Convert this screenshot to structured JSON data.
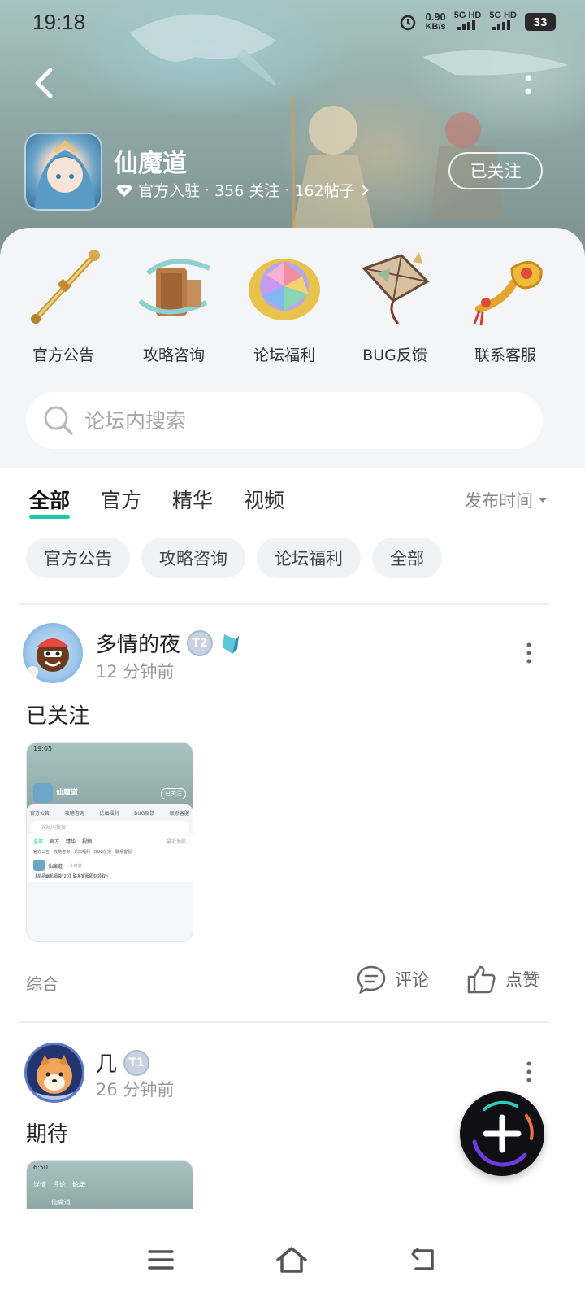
{
  "status_bar": {
    "time": "19:18",
    "net_speed_value": "0.90",
    "net_speed_unit": "KB/s",
    "sim1": "5G HD",
    "sim2": "5G HD",
    "battery": "33"
  },
  "header": {
    "game_title": "仙魔道",
    "meta_official": "官方入驻",
    "meta_follows": "356 关注",
    "meta_posts": "162帖子",
    "separator": "·",
    "follow_label": "已关注"
  },
  "categories": [
    {
      "label": "官方公告",
      "icon": "golden-staff-icon"
    },
    {
      "label": "攻略咨询",
      "icon": "scroll-tome-icon"
    },
    {
      "label": "论坛福利",
      "icon": "rainbow-gem-icon"
    },
    {
      "label": "BUG反馈",
      "icon": "kite-icon"
    },
    {
      "label": "联系客服",
      "icon": "ruyi-scepter-icon"
    }
  ],
  "search": {
    "placeholder": "论坛内搜索"
  },
  "tabs": [
    {
      "label": "全部",
      "active": true
    },
    {
      "label": "官方",
      "active": false
    },
    {
      "label": "精华",
      "active": false
    },
    {
      "label": "视频",
      "active": false
    }
  ],
  "sort_label": "发布时间",
  "chips": [
    "官方公告",
    "攻略咨询",
    "论坛福利",
    "全部"
  ],
  "posts": [
    {
      "username": "多情的夜",
      "level": "T2",
      "time": "12 分钟前",
      "text": "已关注",
      "tag": "综合",
      "comment_label": "评论",
      "like_label": "点赞",
      "thumb": {
        "time": "19:05",
        "game": "仙魔道",
        "follow": "已关注",
        "cats": [
          "官方公告",
          "攻略咨询",
          "论坛福利",
          "BUG反馈",
          "联系客服"
        ],
        "search": "论坛内搜索",
        "tabs": [
          "全部",
          "官方",
          "精华",
          "视频"
        ],
        "sort": "最近发帖",
        "chips": [
          "官方公告",
          "攻略咨询",
          "论坛福利",
          "BUG反馈",
          "联系客服"
        ],
        "post_user": "仙魔道",
        "post_time": "1 小时前",
        "post_line": "【星品幽机福袋*20】联系客服即刻领取~"
      }
    },
    {
      "username": "几",
      "level": "T1",
      "time": "26 分钟前",
      "text": "期待",
      "thumb": {
        "time": "6:50",
        "tabs": [
          "详情",
          "评论",
          "论坛"
        ],
        "game": "仙魔道"
      }
    }
  ],
  "colors": {
    "accent": "#1ec8a5",
    "text_primary": "#222222",
    "text_secondary": "#999999"
  }
}
